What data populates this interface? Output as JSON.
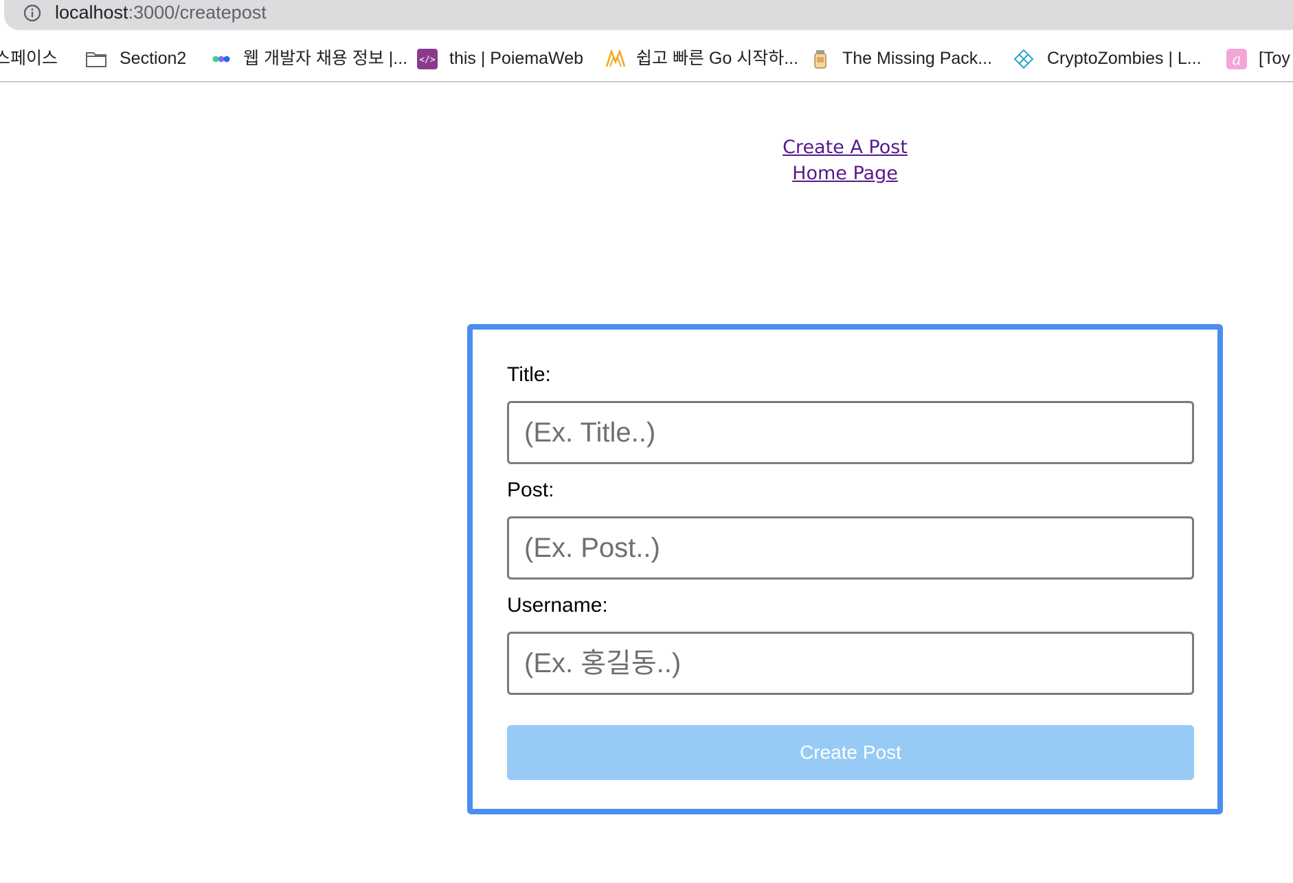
{
  "browser": {
    "url_host": "localhost",
    "url_path": ":3000/createpost",
    "bookmarks": [
      {
        "label": "스페이스",
        "icon": "none"
      },
      {
        "label": "Section2",
        "icon": "folder-icon"
      },
      {
        "label": "웹 개발자 채용 정보 |...",
        "icon": "dots-logo-icon"
      },
      {
        "label": "this | PoiemaWeb",
        "icon": "code-icon"
      },
      {
        "label": "쉽고 빠른 Go 시작하...",
        "icon": "m-logo-icon"
      },
      {
        "label": "The Missing Pack...",
        "icon": "jar-icon"
      },
      {
        "label": "CryptoZombies | L...",
        "icon": "crypto-icon"
      },
      {
        "label": "[Toy",
        "icon": "a-logo-icon"
      }
    ]
  },
  "nav": {
    "create_post_link": "Create A Post",
    "home_page_link": "Home Page"
  },
  "form": {
    "title_label": "Title:",
    "title_placeholder": "(Ex. Title..)",
    "post_label": "Post:",
    "post_placeholder": "(Ex. Post..)",
    "username_label": "Username:",
    "username_placeholder": "(Ex. 홍길동..)",
    "submit_label": "Create Post"
  },
  "colors": {
    "card_border": "#4a8ef0",
    "button_bg": "#97cbf5",
    "link": "#551a8b"
  }
}
